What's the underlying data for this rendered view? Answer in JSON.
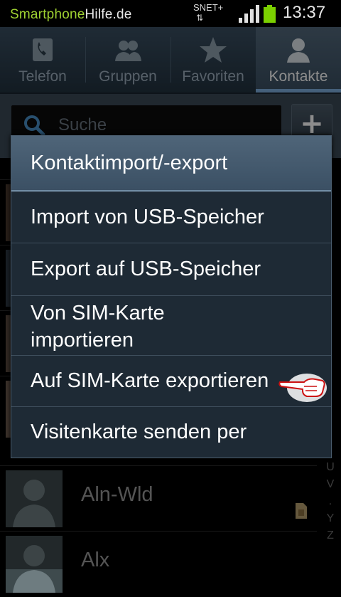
{
  "status_bar": {
    "watermark_part1": "Smartphone",
    "watermark_part2": "Hilfe.de",
    "carrier": "SNET+",
    "data_arrows": "⇅",
    "time": "13:37",
    "battery_color": "#7bd000"
  },
  "tabs": [
    {
      "label": "Telefon",
      "icon": "phone-icon"
    },
    {
      "label": "Gruppen",
      "icon": "groups-icon"
    },
    {
      "label": "Favoriten",
      "icon": "star-icon"
    },
    {
      "label": "Kontakte",
      "icon": "contact-icon",
      "active": true
    }
  ],
  "search": {
    "placeholder": "Suche",
    "add_label": "+"
  },
  "contacts": [
    {
      "name": "Aln-Wld"
    },
    {
      "name": "Alx"
    }
  ],
  "index_letters": [
    "U",
    "V",
    ".",
    "Y",
    "Z"
  ],
  "dialog": {
    "title": "Kontaktimport/-export",
    "items": [
      {
        "line1": "Import von USB-Speicher",
        "line2": ""
      },
      {
        "line1": "Export auf USB-Speicher",
        "line2": ""
      },
      {
        "line1": "Von SIM-Karte",
        "line2": "importieren"
      },
      {
        "line1": "Auf SIM-Karte exportieren",
        "line2": ""
      },
      {
        "line1": "Visitenkarte senden per",
        "line2": ""
      }
    ]
  },
  "colors": {
    "accent": "#7fb0e0",
    "dialog_bg": "#1e2a35",
    "title_bg": "#4f6579",
    "hand_outline": "#cc1111"
  }
}
